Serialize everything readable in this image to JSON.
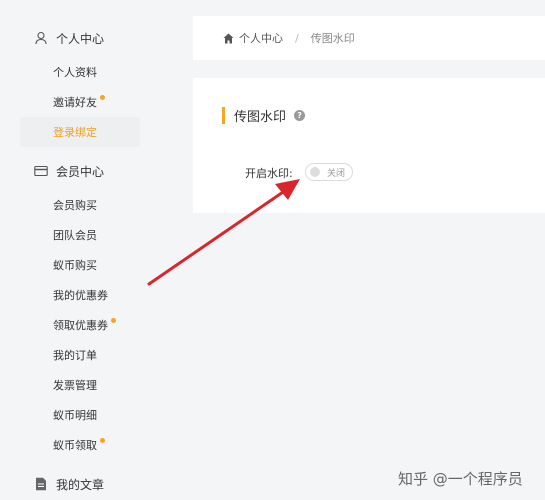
{
  "sidebar": {
    "groups": [
      {
        "title": "个人中心",
        "icon": "user-icon",
        "items": [
          {
            "label": "个人资料",
            "dot": false,
            "active": false
          },
          {
            "label": "邀请好友",
            "dot": true,
            "active": false
          },
          {
            "label": "登录绑定",
            "dot": false,
            "active": true
          }
        ]
      },
      {
        "title": "会员中心",
        "icon": "card-icon",
        "items": [
          {
            "label": "会员购买",
            "dot": false,
            "active": false
          },
          {
            "label": "团队会员",
            "dot": false,
            "active": false
          },
          {
            "label": "蚁币购买",
            "dot": false,
            "active": false
          },
          {
            "label": "我的优惠券",
            "dot": false,
            "active": false
          },
          {
            "label": "领取优惠券",
            "dot": true,
            "active": false
          },
          {
            "label": "我的订单",
            "dot": false,
            "active": false
          },
          {
            "label": "发票管理",
            "dot": false,
            "active": false
          },
          {
            "label": "蚁币明细",
            "dot": false,
            "active": false
          },
          {
            "label": "蚁币领取",
            "dot": true,
            "active": false
          }
        ]
      },
      {
        "title": "我的文章",
        "icon": "document-icon",
        "items": []
      }
    ]
  },
  "breadcrumb": {
    "home_label": "个人中心",
    "separator": "/",
    "current": "传图水印"
  },
  "main": {
    "title": "传图水印",
    "help_icon_glyph": "?",
    "field_label": "开启水印:",
    "switch_state_label": "关闭",
    "switch_on": false
  },
  "watermark": "知乎 @一个程序员",
  "colors": {
    "accent": "#f5a623",
    "active_text": "#f0a020",
    "annotation_arrow": "#d9262c"
  }
}
